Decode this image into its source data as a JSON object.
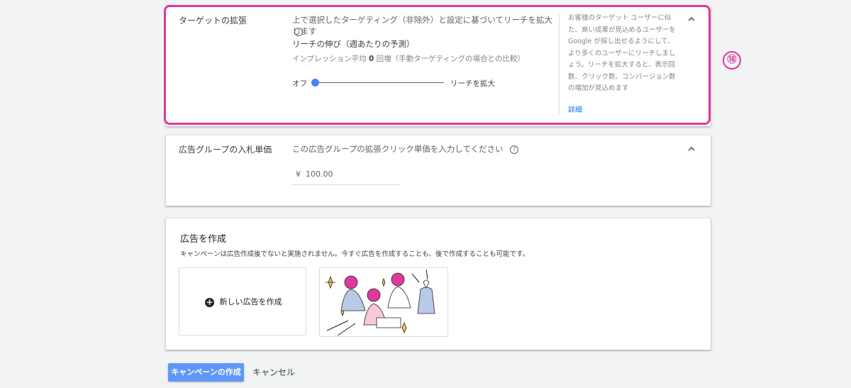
{
  "targeting": {
    "title": "ターゲットの拡張",
    "description": "上で選択したターゲティング（非除外）と設定に基づいてリーチを拡大します",
    "help": "?",
    "reach_heading": "リーチの伸び（週あたりの予測）",
    "impressions_prefix": "インプレッション平均 ",
    "impressions_value": "0",
    "impressions_suffix": " 回増（手動ターゲティングの場合との比較）",
    "slider_min_label": "オフ",
    "slider_max_label": "リーチを拡大",
    "slider_level": 0,
    "side_text": "お客様のターゲット ユーザーに似た、高い成果が見込めるユーザーを Google が探し出せるようにして、より多くのユーザーにリーチしましょう。リーチを拡大すると、表示回数、クリック数、コンバージョン数の増加が見込めます",
    "side_link": "詳細",
    "collapse_icon": "chevron-up-icon"
  },
  "annotation_badge": "⑱",
  "bid": {
    "title": "広告グループの入札単価",
    "description": "この広告グループの拡張クリック単価を入力してください",
    "help": "?",
    "currency": "¥",
    "value": "100.00",
    "collapse_icon": "chevron-up-icon"
  },
  "create_ad": {
    "title": "広告を作成",
    "description": "キャンペーンは広告作成後でないと実施されません。今すぐ広告を作成することも、後で作成することも可能です。",
    "new_ad_label": "新しい広告を作成"
  },
  "footer": {
    "create_campaign": "キャンペーンの作成",
    "cancel": "キャンセル"
  },
  "colors": {
    "highlight": "#e0399a",
    "primary": "#5e97f6",
    "link": "#1a73e8",
    "slider": "#4285f4"
  }
}
